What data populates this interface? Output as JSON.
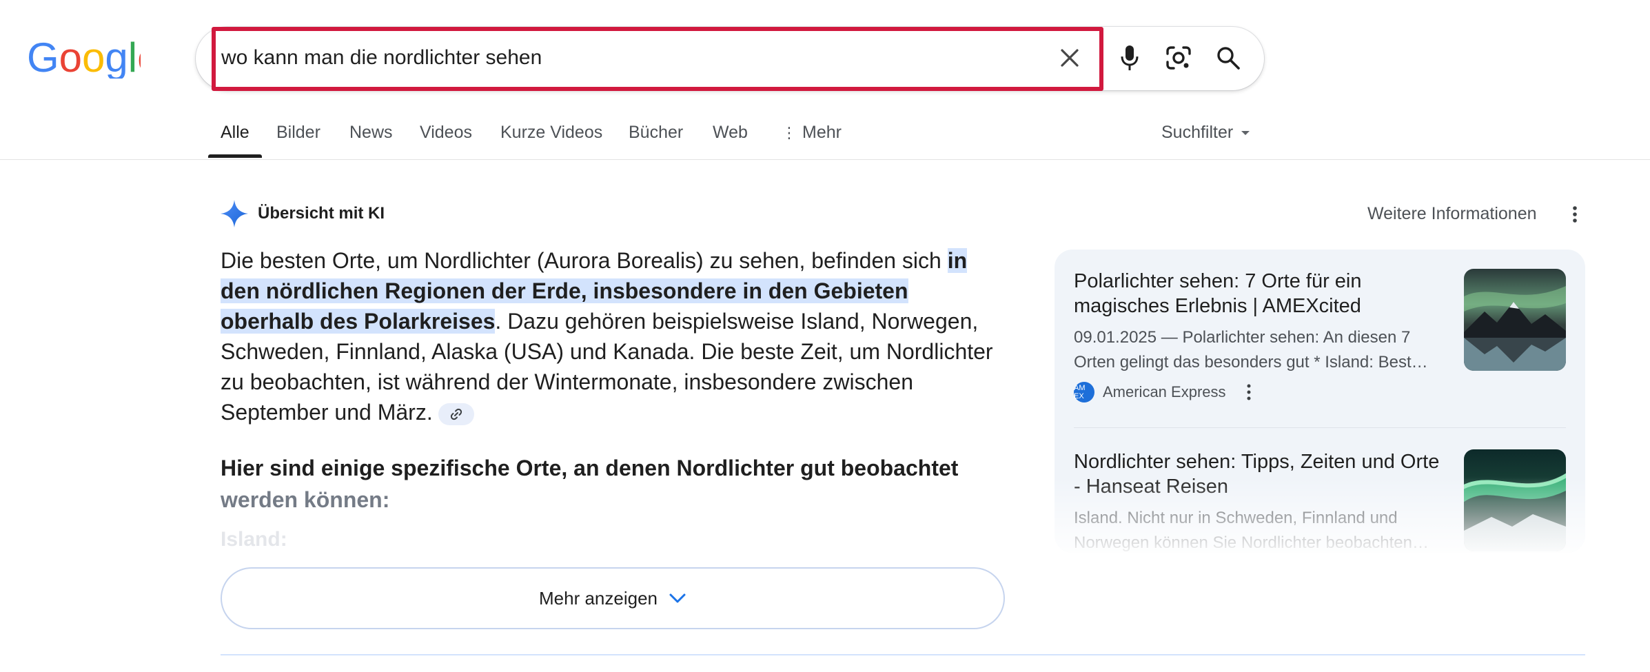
{
  "logo": {
    "letters": [
      "G",
      "o",
      "o",
      "g",
      "l",
      "e"
    ],
    "colors": [
      "#4285F4",
      "#EA4335",
      "#FBBC05",
      "#4285F4",
      "#34A853",
      "#EA4335"
    ]
  },
  "search": {
    "query": "wo kann man die nordlichter sehen",
    "highlight_color": "#d1193e"
  },
  "tabs": {
    "items": [
      {
        "label": "Alle"
      },
      {
        "label": "Bilder"
      },
      {
        "label": "News"
      },
      {
        "label": "Videos"
      },
      {
        "label": "Kurze Videos"
      },
      {
        "label": "Bücher"
      },
      {
        "label": "Web"
      },
      {
        "label": "Mehr"
      }
    ],
    "filter_label": "Suchfilter"
  },
  "ai_overview": {
    "title": "Übersicht mit KI",
    "more_info": "Weitere Informationen",
    "text_before": "Die besten Orte, um Nordlichter (Aurora Borealis) zu sehen, befinden sich ",
    "text_highlight": "in den nördlichen Regionen der Erde, insbesondere in den Gebieten oberhalb des Polarkreises",
    "text_after": ". Dazu gehören beispielsweise Island, Norwegen, Schweden, Finnland, Alaska (USA) und Kanada. Die beste Zeit, um Nordlichter zu beobachten, ist während der Wintermonate, insbesondere zwischen September und März.",
    "subhead_line1": "Hier sind einige spezifische Orte, an denen Nordlichter gut beobachtet",
    "subhead_line2": "werden können:",
    "faded_item": "Island:",
    "show_more": "Mehr anzeigen",
    "accent_color": "#1a73e8"
  },
  "sources": [
    {
      "title": "Polarlichter sehen: 7 Orte für ein magisches Erlebnis | AMEXcited",
      "snippet": "09.01.2025 — Polarlichter sehen: An diesen 7 Orten gelingt das besonders gut * Island: Best…",
      "site": "American Express",
      "site_logo": "AM EX"
    },
    {
      "title": "Nordlichter sehen: Tipps, Zeiten und Orte - Hanseat Reisen",
      "snippet": "Island. Nicht nur in Schweden, Finnland und Norwegen können Sie Nordlichter beobachten…"
    }
  ]
}
